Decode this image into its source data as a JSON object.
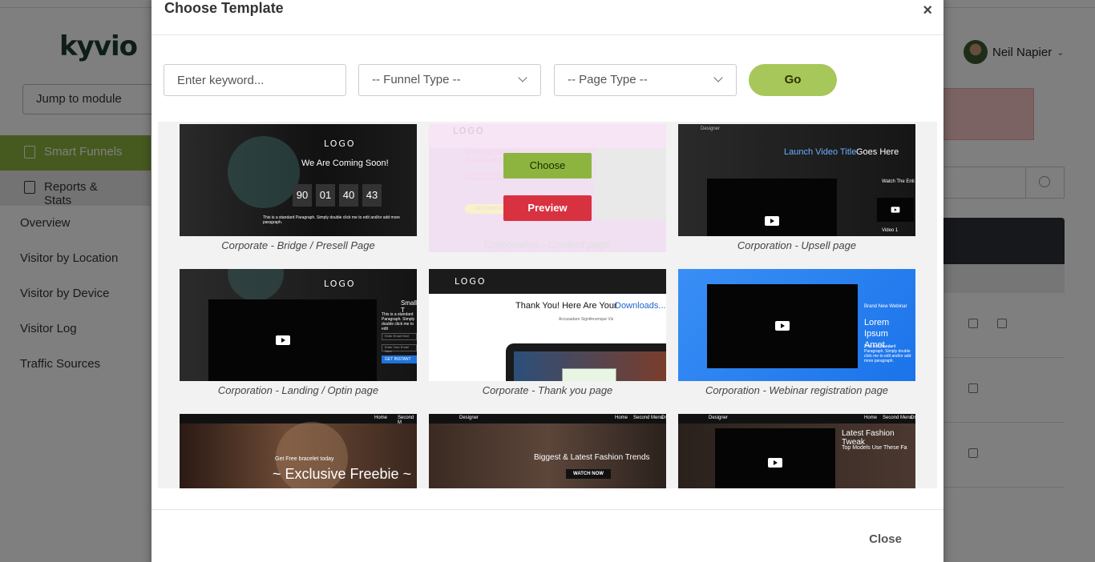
{
  "app": {
    "logo_text": "kyvio",
    "jump_label": "Jump to module",
    "sidebar": {
      "smart_funnels": "Smart Funnels",
      "reports_stats": "Reports & Stats",
      "sub_items": [
        "Overview",
        "Visitor by Location",
        "Visitor by Device",
        "Visitor Log",
        "Traffic Sources"
      ]
    },
    "user_name": "Neil Napier"
  },
  "modal": {
    "title": "Choose Template",
    "close_x": "×",
    "filters": {
      "keyword_placeholder": "Enter keyword...",
      "funnel_type": "-- Funnel Type --",
      "page_type": "-- Page Type --",
      "go_label": "Go"
    },
    "hover_actions": {
      "choose": "Choose",
      "preview": "Preview"
    },
    "templates": [
      {
        "caption": "Corporate - Bridge / Presell Page",
        "logo": "LOGO",
        "headline": "We Are Coming Soon!",
        "countdown": [
          "90",
          "01",
          "40",
          "43"
        ],
        "body": "This is a standard Paragraph. Simply double click me to edit and/or add more paragraph."
      },
      {
        "caption": "Corporation - Content page",
        "logo": "LOGO",
        "headline": "5 Things Before You Start D...",
        "body": "Kaberit adipiscing elit labore vel et magna tempor.",
        "get_started": "GET STARTED"
      },
      {
        "caption": "Corporation - Upsell page",
        "brand": "Designer",
        "headline_blue": "Launch Video Title",
        "headline_white": "Goes Here",
        "side_title": "Watch The Enti",
        "video_label": "Video 1"
      },
      {
        "caption": "Corporation - Landing / Optin page",
        "logo": "LOGO",
        "side_title": "Small T",
        "body": "This is a standard Paragraph. Simply double click me to edit",
        "input_placeholder": "Enter Email Here",
        "input2_placeholder": "Enter Your Email Here",
        "cta": "GET INSTANT"
      },
      {
        "caption": "Corporate - Thank you page",
        "logo": "LOGO",
        "headline": "Thank You! Here Are Your",
        "headline_blue": "Downloads...",
        "subline": "Accusadare Signiferumque Vis"
      },
      {
        "caption": "Corporation - Webinar registration page",
        "eyebrow": "Brand New Webinar",
        "headline": "Lorem Ipsum Amet...",
        "body": "This is a standard Paragraph. Simply double click me to edit and/or add more paragraph."
      },
      {
        "caption": "",
        "headline_small": "Get Free bracelet today",
        "headline": "~ Exclusive Freebie ~",
        "nav": [
          "Home",
          "Second M"
        ]
      },
      {
        "caption": "",
        "brand": "Designer",
        "headline": "Biggest & Latest Fashion Trends",
        "cta": "WATCH NOW",
        "nav": [
          "Home",
          "Second Menu",
          "Dr"
        ]
      },
      {
        "caption": "",
        "brand": "Designer",
        "headline": "Latest Fashion Tweak",
        "subline": "Top Models Use These Fa",
        "nav": [
          "Home",
          "Second Menu",
          "Dr"
        ]
      }
    ],
    "footer_close": "Close"
  },
  "colors": {
    "accent_green": "#8db43f",
    "go_green": "#a8c75a",
    "preview_red": "#d83140",
    "link_blue": "#4aa3ff"
  }
}
